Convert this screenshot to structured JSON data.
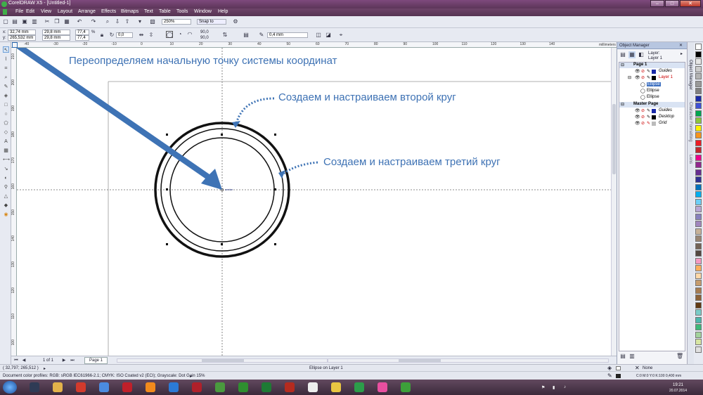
{
  "window": {
    "title": "CorelDRAW X5 - [Untitled-1]",
    "buttons": {
      "minimize": "–",
      "maximize": "□",
      "close": "✕"
    }
  },
  "menu": [
    "File",
    "Edit",
    "View",
    "Layout",
    "Arrange",
    "Effects",
    "Bitmaps",
    "Text",
    "Table",
    "Tools",
    "Window",
    "Help"
  ],
  "toolbar": {
    "zoom": "250%",
    "snap_to": "Snap to",
    "outline_width": "0,4 mm"
  },
  "property_bar": {
    "x": "32,74 mm",
    "y": "265,532 mm",
    "width": "29,8 mm",
    "height": "29,8 mm",
    "scale_x": "77,4",
    "scale_y": "77,4",
    "percent": "%",
    "rotation": "0,0",
    "angle_start": "90,0",
    "angle_end": "90,0",
    "x_label": "x:",
    "y_label": "y:"
  },
  "ruler": {
    "units": "millimeters",
    "h_ticks": [
      "-40",
      "-30",
      "-20",
      "-10",
      "0",
      "10",
      "20",
      "30",
      "40",
      "50",
      "60",
      "70",
      "80",
      "90",
      "100",
      "110",
      "120",
      "130",
      "140"
    ],
    "v_ticks": [
      "210",
      "200",
      "190",
      "180",
      "170",
      "160",
      "150",
      "140",
      "130",
      "120",
      "110",
      "100"
    ]
  },
  "canvas": {
    "center_label": "center"
  },
  "annotations": {
    "redefine_origin": "Переопределяем начальную точку системы координат",
    "second_circle": "Создаем и настраиваем второй круг",
    "third_circle": "Создаем и настраиваем третий круг"
  },
  "page_nav": {
    "page_count": "1 of 1",
    "page_tab": "Page 1"
  },
  "object_manager": {
    "title": "Object Manager",
    "layer_info_label": "Layer:",
    "layer_info_value": "Layer 1",
    "page1": "Page 1",
    "guides": "Guides",
    "layer1": "Layer 1",
    "ellipses": [
      "Ellipse",
      "Ellipse",
      "Ellipse"
    ],
    "master_page": "Master Page",
    "master_guides": "Guides",
    "desktop": "Desktop",
    "grid": "Grid"
  },
  "docker_tabs": [
    "Object Manager",
    "Character Formatting",
    "Lens"
  ],
  "palette": [
    "#ffffff",
    "#000000",
    "#e6e6e6",
    "#cccccc",
    "#b3b3b3",
    "#999999",
    "#808080",
    "#1a2aa8",
    "#3f51d6",
    "#00a651",
    "#8dc63f",
    "#fff200",
    "#f7941d",
    "#ed1c24",
    "#c1272d",
    "#ec008c",
    "#92278f",
    "#662d91",
    "#2e3192",
    "#0072bc",
    "#00aeef",
    "#6dcff6",
    "#b8a7d6",
    "#8781bd",
    "#a186be",
    "#c7b299",
    "#998675",
    "#736357",
    "#534741",
    "#f49ac2",
    "#fbaf5d",
    "#ffd8a8",
    "#c69c6d",
    "#a67c52",
    "#8c6239",
    "#603913",
    "#7accc8",
    "#4db6ac",
    "#3cb878",
    "#a3d39c",
    "#d7e6a3",
    "#e0e0e0"
  ],
  "status": {
    "coords": "( 32,797; 265,512 )",
    "object_info": "Ellipse on Layer 1",
    "color_profiles": "Document color profiles: RGB: sRGB IEC61966-2.1; CMYK: ISO Coated v2 (ECI); Grayscale: Dot Gain 15%",
    "fill": "None",
    "outline": "C:0 M:0 Y:0 K:100  0,400 mm"
  },
  "taskbar": {
    "time": "19:21",
    "date": "20.07.2014",
    "apps": [
      "start-button",
      "explorer-grid",
      "folder",
      "gmail",
      "chrome",
      "opera",
      "firefox",
      "ie",
      "red-ball",
      "coreldraw-app",
      "photo-app",
      "excel-green",
      "filezilla",
      "text-a",
      "icon-yellow",
      "icon-drive",
      "icon-mail",
      "corel-active"
    ]
  }
}
